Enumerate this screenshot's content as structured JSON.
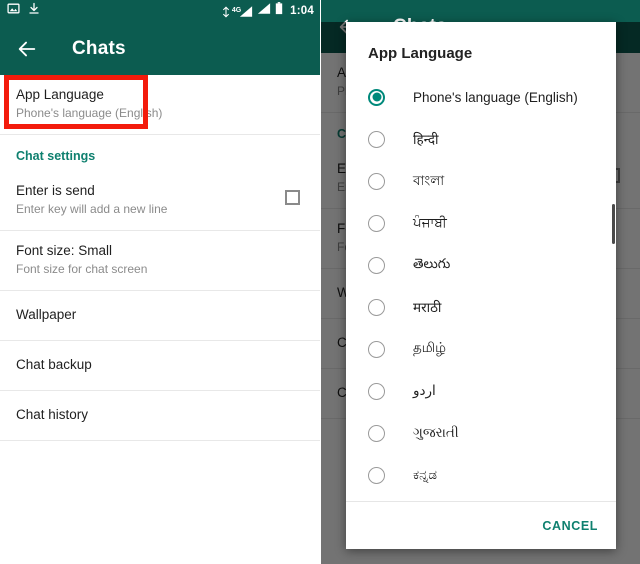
{
  "status_bar": {
    "icons_left": [
      "image-icon",
      "download-icon"
    ],
    "network_label": "4G",
    "icons_right": [
      "signal-4g-icon",
      "signal-icon",
      "battery-icon"
    ],
    "time": "1:04"
  },
  "app_bar": {
    "back_icon": "back-arrow-icon",
    "title": "Chats"
  },
  "settings": {
    "app_language": {
      "title": "App Language",
      "subtitle": "Phone's language (English)",
      "highlighted": true
    },
    "section_label": "Chat settings",
    "rows": [
      {
        "title": "Enter is send",
        "subtitle": "Enter key will add a new line",
        "control": "checkbox",
        "checked": false
      },
      {
        "title": "Font size: Small",
        "subtitle": "Font size for chat screen",
        "control": "none"
      },
      {
        "title": "Wallpaper",
        "subtitle": "",
        "control": "none"
      },
      {
        "title": "Chat backup",
        "subtitle": "",
        "control": "none"
      },
      {
        "title": "Chat history",
        "subtitle": "",
        "control": "none"
      }
    ]
  },
  "dialog": {
    "title": "App Language",
    "options": [
      {
        "label": "Phone's language (English)",
        "selected": true
      },
      {
        "label": "हिन्दी",
        "selected": false
      },
      {
        "label": "বাংলা",
        "selected": false
      },
      {
        "label": "ਪੰਜਾਬੀ",
        "selected": false
      },
      {
        "label": "తెలుగు",
        "selected": false
      },
      {
        "label": "मराठी",
        "selected": false
      },
      {
        "label": "தமிழ்",
        "selected": false
      },
      {
        "label": "اردو",
        "selected": false,
        "rtl": true
      },
      {
        "label": "ગુજરાતી",
        "selected": false
      },
      {
        "label": "ಕನ್ನಡ",
        "selected": false
      }
    ],
    "cancel_label": "CANCEL"
  },
  "colors": {
    "header_teal": "#0c5c50",
    "accent_teal": "#0f806f",
    "radio_selected": "#00897b",
    "highlight_red": "#f31b0c",
    "text_primary": "#1f1f1f",
    "text_secondary": "#8b8b8b"
  }
}
